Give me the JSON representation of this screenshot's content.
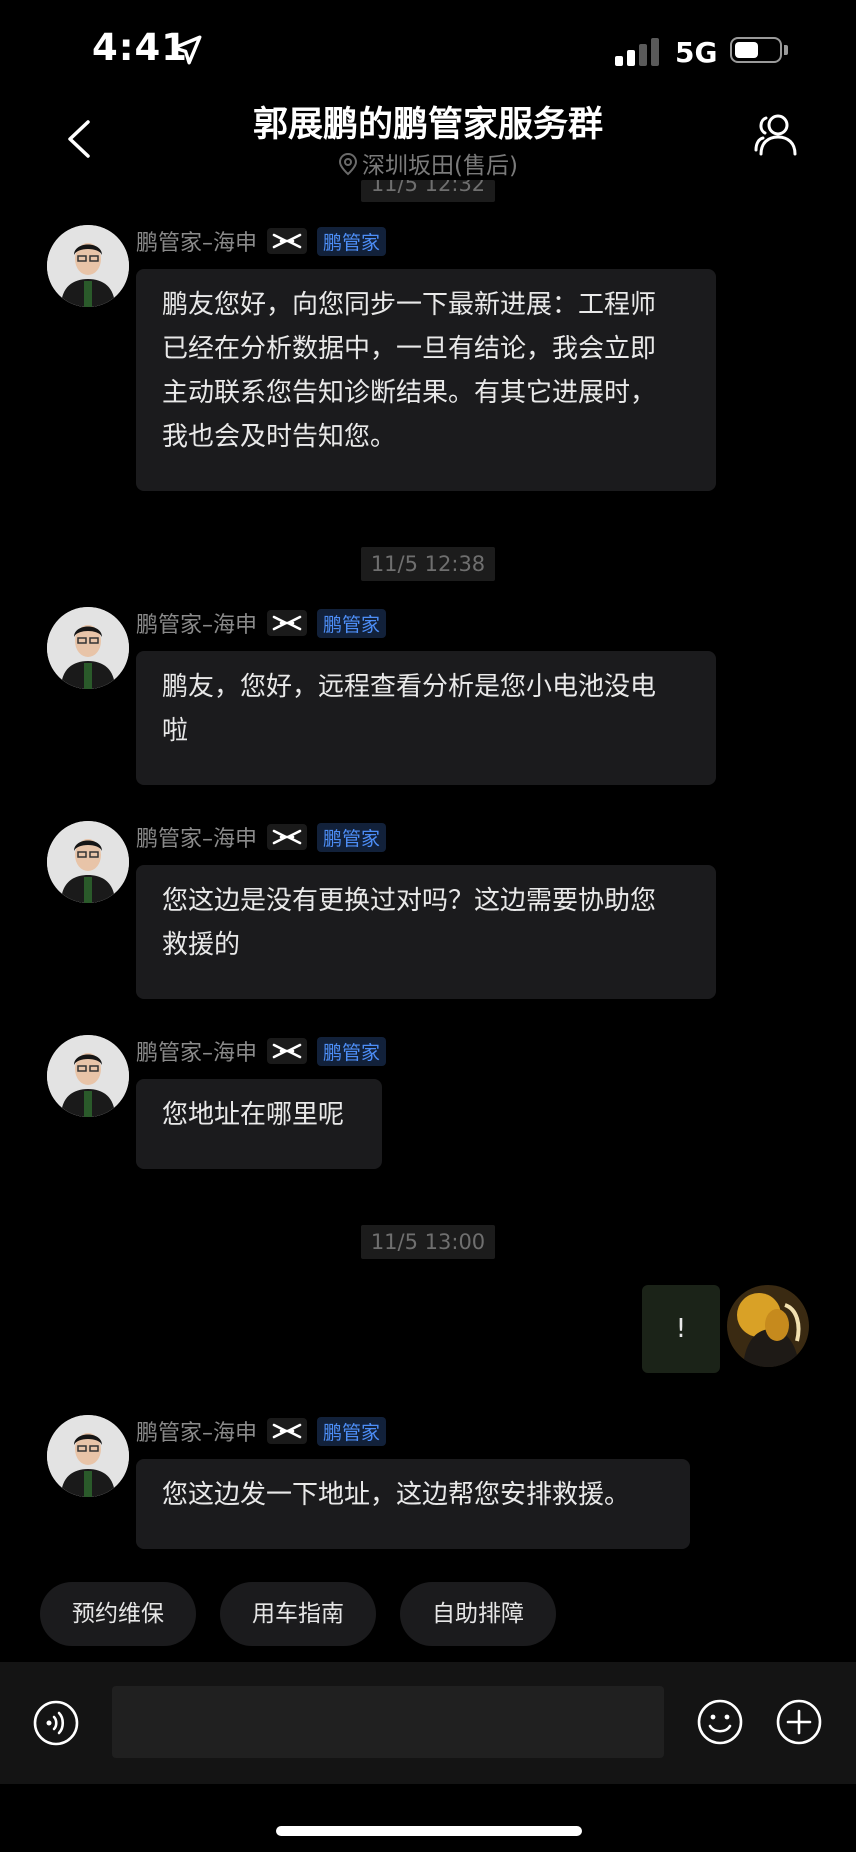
{
  "status_bar": {
    "time": "4:41",
    "network": "5G",
    "battery_level": 0.55
  },
  "header": {
    "title": "郭展鹏的鹏管家服务群",
    "subtitle": "深圳坂田(售后)"
  },
  "timestamps": {
    "top_partial": "11/5 12:32",
    "second": "11/5 12:38",
    "third": "11/5 13:00"
  },
  "sender": {
    "name": "鹏管家–海申",
    "role": "鹏管家"
  },
  "messages": [
    {
      "text": "鹏友您好，向您同步一下最新进展：工程师\n已经在分析数据中，一旦有结论，我会立即\n主动联系您告知诊断结果。有其它进展时，\n我也会及时告知您。"
    },
    {
      "text": "鹏友，您好，远程查看分析是您小电池没电\n啦"
    },
    {
      "text": "您这边是没有更换过对吗？这边需要协助您\n救援的"
    },
    {
      "text": "您地址在哪里呢"
    },
    {
      "text": "您这边发一下地址，这边帮您安排救援。"
    }
  ],
  "self_message": {
    "text": "!"
  },
  "quick_replies": [
    {
      "label": "预约维保"
    },
    {
      "label": "用车指南"
    },
    {
      "label": "自助排障"
    }
  ],
  "composer": {
    "value": "",
    "placeholder": ""
  }
}
